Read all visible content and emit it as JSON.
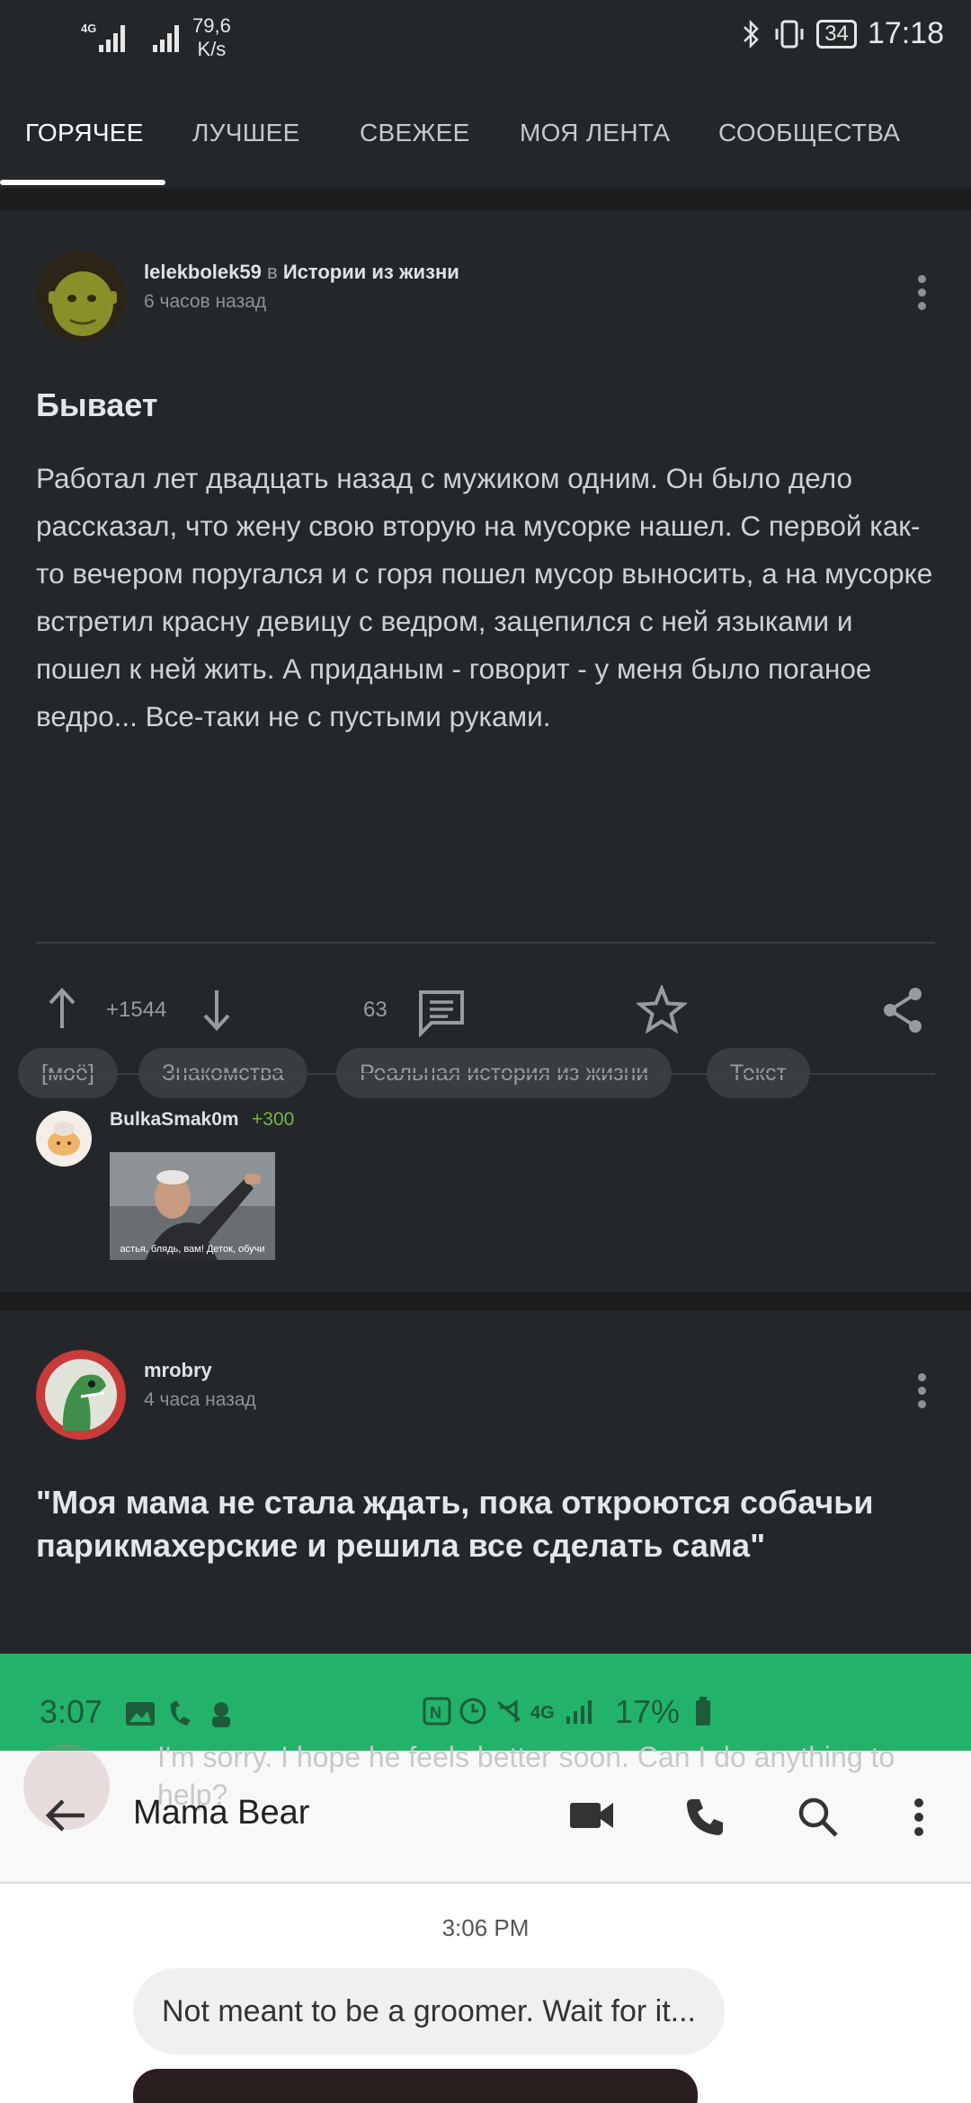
{
  "status_bar": {
    "speed": "79,6",
    "speed_unit": "K/s",
    "battery": "34",
    "time": "17:18"
  },
  "tabs": [
    {
      "label": "ГОРЯЧЕЕ"
    },
    {
      "label": "ЛУЧШЕЕ"
    },
    {
      "label": "СВЕЖЕЕ"
    },
    {
      "label": "МОЯ ЛЕНТА"
    },
    {
      "label": "СООБЩЕСТВА"
    }
  ],
  "post1": {
    "author": "lelekbolek59",
    "in_word": "в",
    "community": "Истории из жизни",
    "time": "6 часов назад",
    "title": "Бывает",
    "body": "Работал лет двадцать назад с мужиком одним. Он было дело рассказал, что жену свою вторую на мусорке нашел. С первой как-то вечером поругался и с горя пошел мусор выносить, а на мусорке встретил красну девицу с ведром, зацепился с ней языками и пошел к ней жить. А приданым - говорит - у меня было поганое ведро... Все-таки не с пустыми руками.",
    "tags": [
      "[моё]",
      "Знакомства",
      "Реальная история из жизни",
      "Текст"
    ],
    "rating": "+1544",
    "comments": "63",
    "top_comment": {
      "author": "BulkaSmak0m",
      "rating": "+300",
      "image_caption": "астья, блядь, вам! Деток, обучи"
    }
  },
  "post2": {
    "author": "mrobry",
    "time": "4 часа назад",
    "title": "\"Моя мама не стала ждать, пока откроются собачьи парикмахерские и решила все сделать сама\"",
    "screenshot": {
      "time": "3:07",
      "battery": "17%",
      "ghost_text": "I'm sorry. I hope he feels better soon. Can I do anything to help?",
      "contact": "Mama Bear",
      "timestamp": "3:06 PM",
      "message": "Not meant to be a groomer. Wait for it..."
    }
  }
}
